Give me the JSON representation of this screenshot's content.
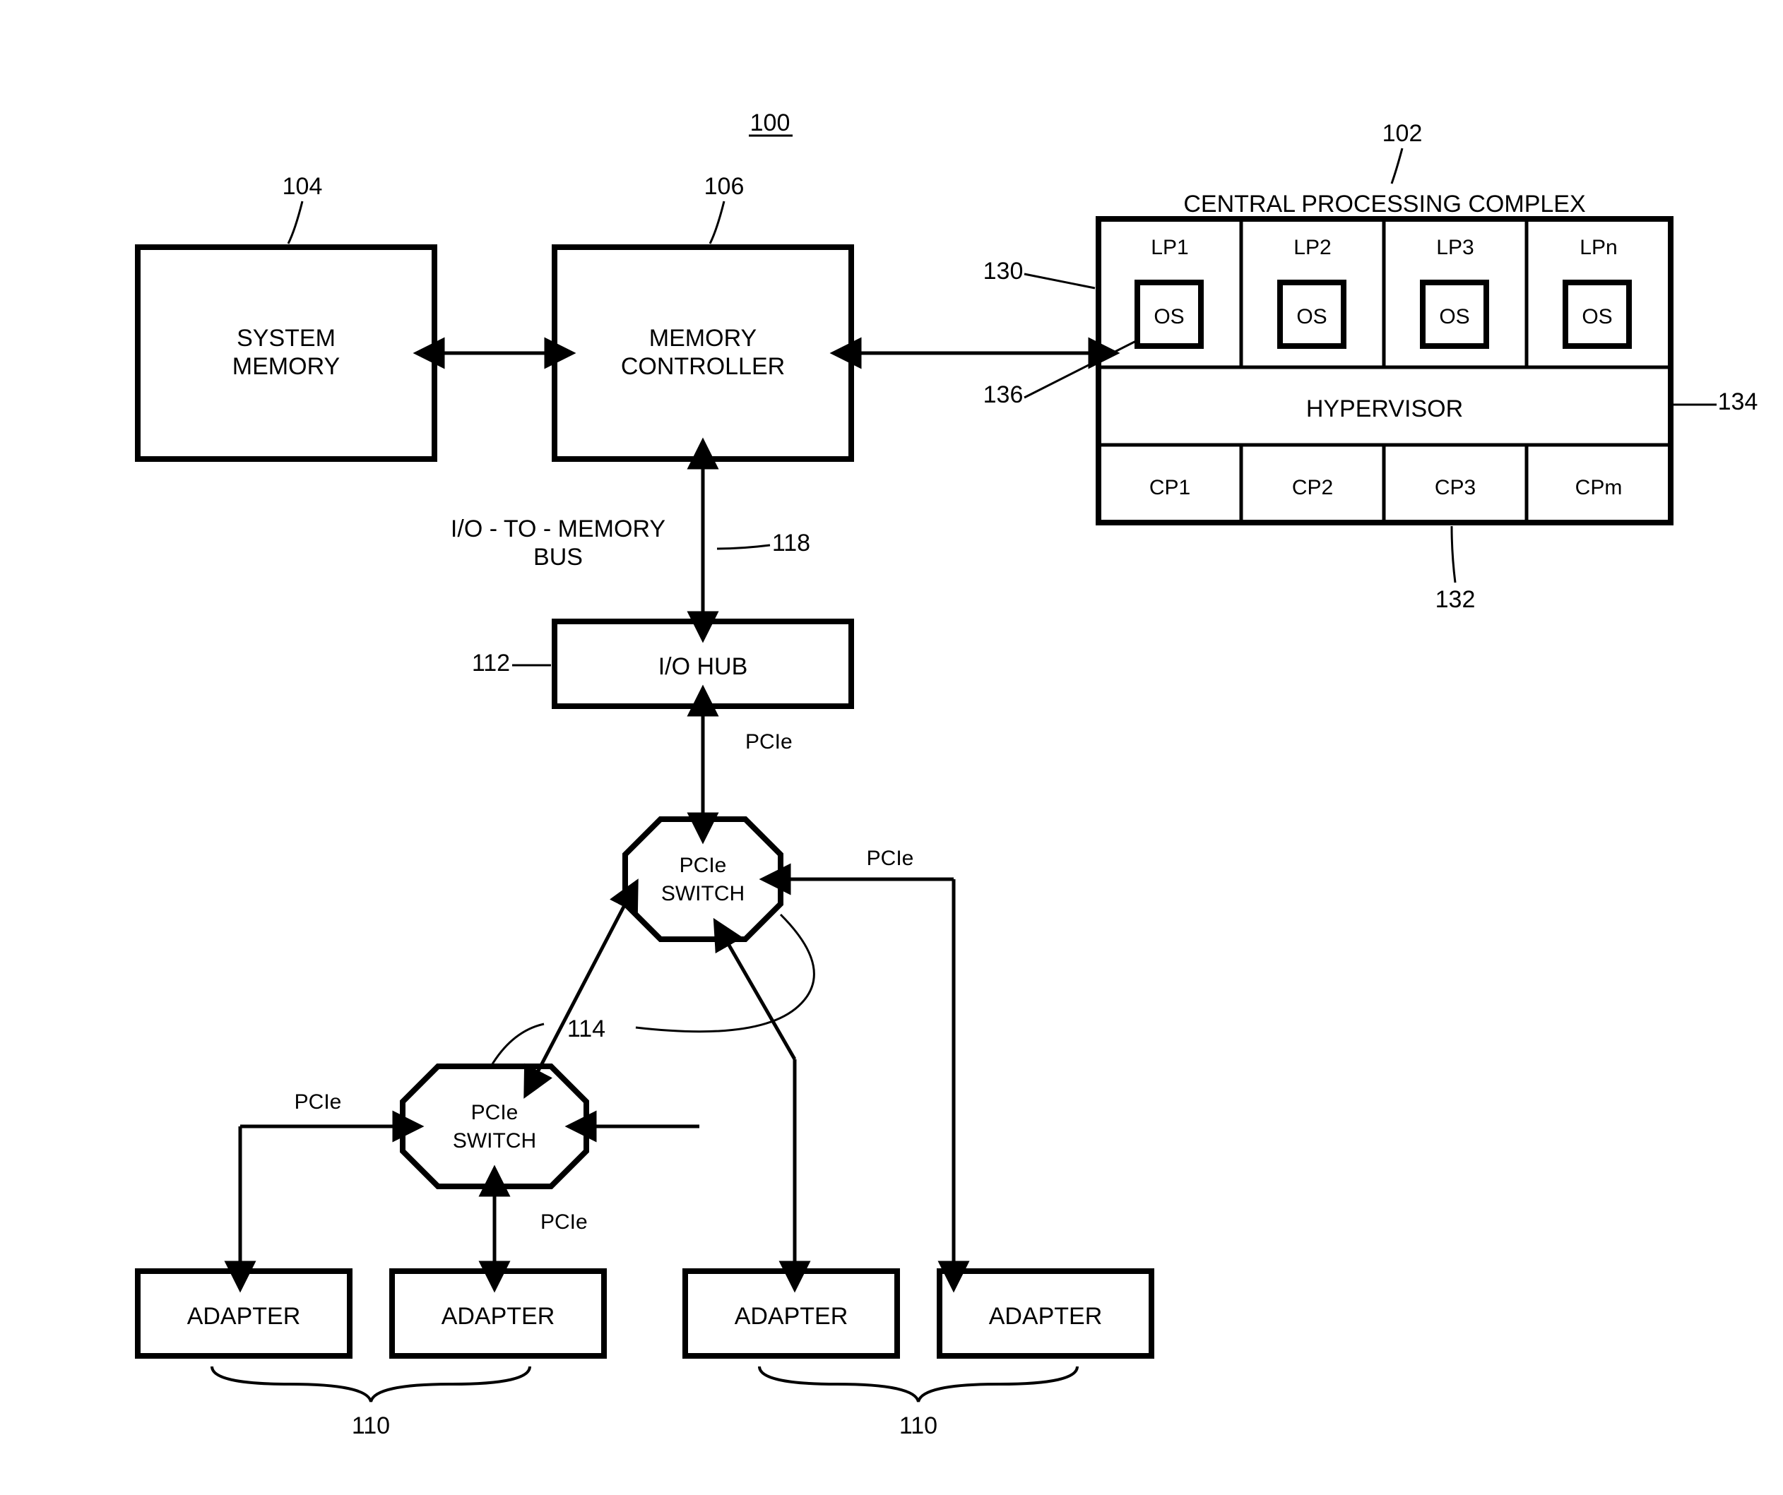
{
  "refs": {
    "main": "100",
    "cpc": "102",
    "sysmem": "104",
    "memctl": "106",
    "adapters": "110",
    "iohub": "112",
    "switch": "114",
    "bus": "118",
    "lp": "130",
    "cp": "132",
    "hyp": "134",
    "os": "136"
  },
  "bus_label_top": "I/O - TO - MEMORY",
  "bus_label_bot": "BUS",
  "blk": {
    "sysmem_l1": "SYSTEM",
    "sysmem_l2": "MEMORY",
    "memctl_l1": "MEMORY",
    "memctl_l2": "CONTROLLER",
    "iohub": "I/O HUB",
    "pcie_sw_l1": "PCIe",
    "pcie_sw_l2": "SWITCH",
    "adapter": "ADAPTER"
  },
  "cpc": {
    "title": "CENTRAL PROCESSING COMPLEX",
    "lp": [
      "LP1",
      "LP2",
      "LP3",
      "LPn"
    ],
    "os": "OS",
    "hypervisor": "HYPERVISOR",
    "cp": [
      "CP1",
      "CP2",
      "CP3",
      "CPm"
    ]
  },
  "link": "PCIe"
}
